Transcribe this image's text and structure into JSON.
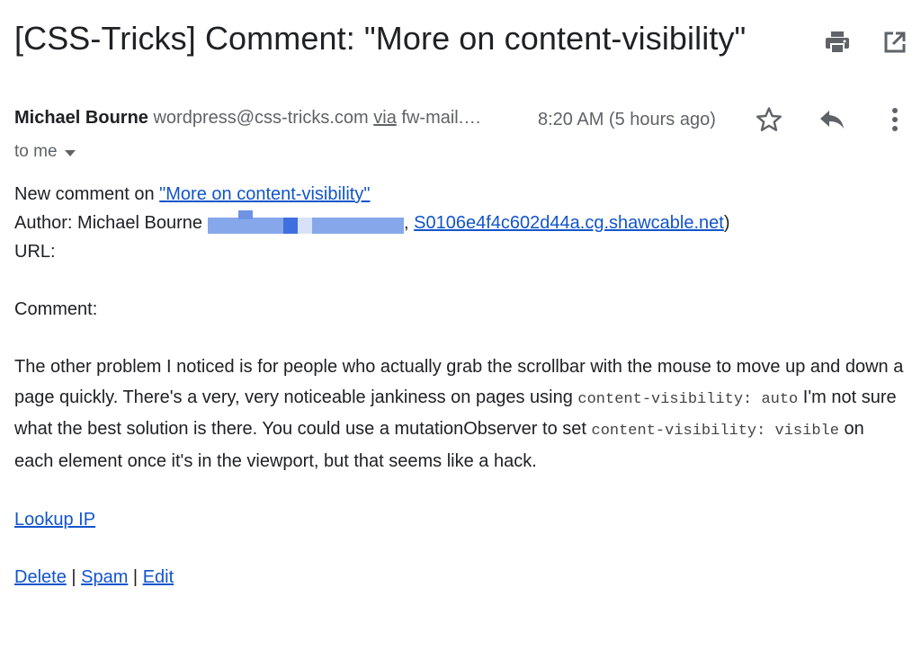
{
  "email": {
    "subject": "[CSS-Tricks] Comment: \"More on content-visibility\"",
    "sender_name": "Michael Bourne",
    "sender_email": "wordpress@css-tricks.com",
    "via_label": "via",
    "via_host": "fw-mail.…",
    "time": "8:20 AM (5 hours ago)",
    "to": "to me",
    "icons": {
      "print": "print-icon",
      "open_new_window": "open-in-new-icon",
      "star": "star-icon",
      "reply": "reply-icon",
      "more": "more-vert-icon"
    }
  },
  "body": {
    "new_comment_prefix": "New comment on ",
    "post_link": "\"More on content-visibility\"",
    "author_prefix": "Author: Michael Bourne",
    "author_sep": ", ",
    "host_link": "S0106e4f4c602d44a.cg.shawcable.net",
    "author_suffix": ")",
    "url_label": "URL:",
    "comment_label": "Comment:",
    "comment_part1": "The other problem I noticed is for people who actually grab the scrollbar with the mouse to move up and down a page quickly. There's a very, very noticeable jankiness on pages using ",
    "code1": "content-visibility: auto",
    "comment_part2": " I'm not sure what the best solution is there. You could use a mutationObserver to set ",
    "code2": "content-visibility: visible",
    "comment_part3": " on each element once it's in the viewport, but that seems like a hack.",
    "lookup_ip": "Lookup IP",
    "delete": "Delete",
    "sep1": " | ",
    "spam": "Spam",
    "sep2": " | ",
    "edit": "Edit"
  },
  "colors": {
    "link": "#1155cc",
    "redaction": "#86a8ea"
  }
}
